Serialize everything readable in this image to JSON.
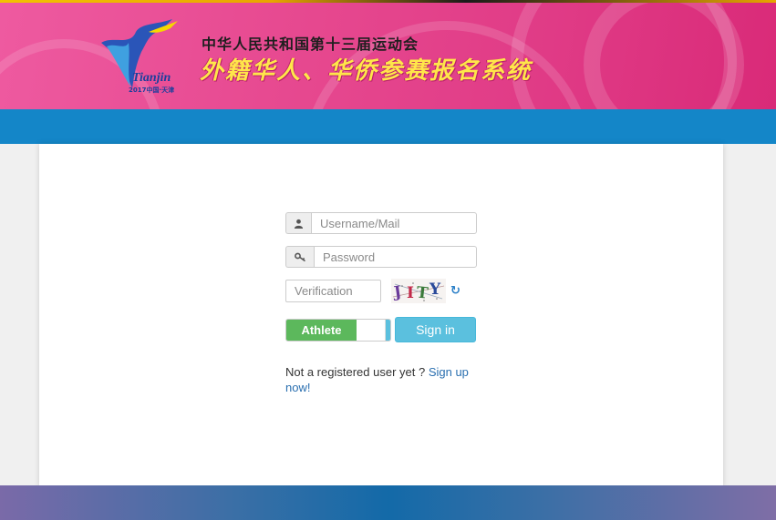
{
  "header": {
    "subtitle": "中华人民共和国第十三届运动会",
    "title": "外籍华人、华侨参赛报名系统",
    "logo_text": "Tianjin",
    "logo_year": "2017中国·天津"
  },
  "login": {
    "username_placeholder": "Username/Mail",
    "password_placeholder": "Password",
    "verification_placeholder": "Verification",
    "captcha_text": "JITY",
    "user_type": "Athlete",
    "signin_label": "Sign in",
    "register_prompt": "Not a registered user yet ? ",
    "register_link": "Sign up now!"
  },
  "colors": {
    "banner": "#e6488f",
    "blue_band": "#1486c8",
    "toggle_on": "#5cb85c",
    "signin": "#5bc0de"
  },
  "icons": {
    "username": "user-icon",
    "password": "key-icon",
    "refresh": "refresh-icon"
  }
}
